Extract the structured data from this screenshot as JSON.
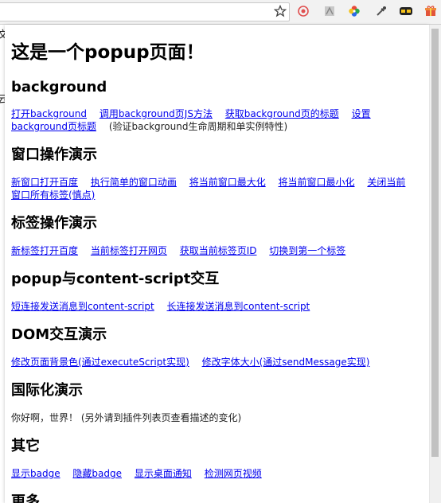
{
  "browser": {
    "behind_chars": [
      "文",
      "云"
    ],
    "toolbar_icons": [
      "star-icon",
      "extension-red-icon",
      "extension-pdf-icon",
      "extension-colorwheel-icon",
      "eyedropper-icon",
      "extension-mask-icon",
      "gift-icon"
    ]
  },
  "popup": {
    "title": "这是一个popup页面！",
    "sections": [
      {
        "heading": "background",
        "links": [
          "打开background",
          "调用background页JS方法",
          "获取background页的标题",
          "设置background页标题"
        ],
        "note": "(验证background生命周期和单实例特性)"
      },
      {
        "heading": "窗口操作演示",
        "links": [
          "新窗口打开百度",
          "执行简单的窗口动画",
          "将当前窗口最大化",
          "将当前窗口最小化",
          "关闭当前窗口所有标签(慎点)"
        ],
        "note": ""
      },
      {
        "heading": "标签操作演示",
        "links": [
          "新标签打开百度",
          "当前标签打开网页",
          "获取当前标签页ID",
          "切换到第一个标签"
        ],
        "note": ""
      },
      {
        "heading": "popup与content-script交互",
        "links": [
          "短连接发送消息到content-script",
          "长连接发送消息到content-script"
        ],
        "note": ""
      },
      {
        "heading": "DOM交互演示",
        "links": [
          "修改页面背景色(通过executeScript实现)",
          "修改字体大小(通过sendMessage实现)"
        ],
        "note": ""
      },
      {
        "heading": "国际化演示",
        "links": [],
        "note": "你好啊，世界！ (另外请到插件列表页查看描述的变化)"
      },
      {
        "heading": "其它",
        "links": [
          "显示badge",
          "隐藏badge",
          "显示桌面通知",
          "检测网页视频"
        ],
        "note": ""
      },
      {
        "heading": "更多",
        "links": [],
        "note": ""
      }
    ]
  }
}
